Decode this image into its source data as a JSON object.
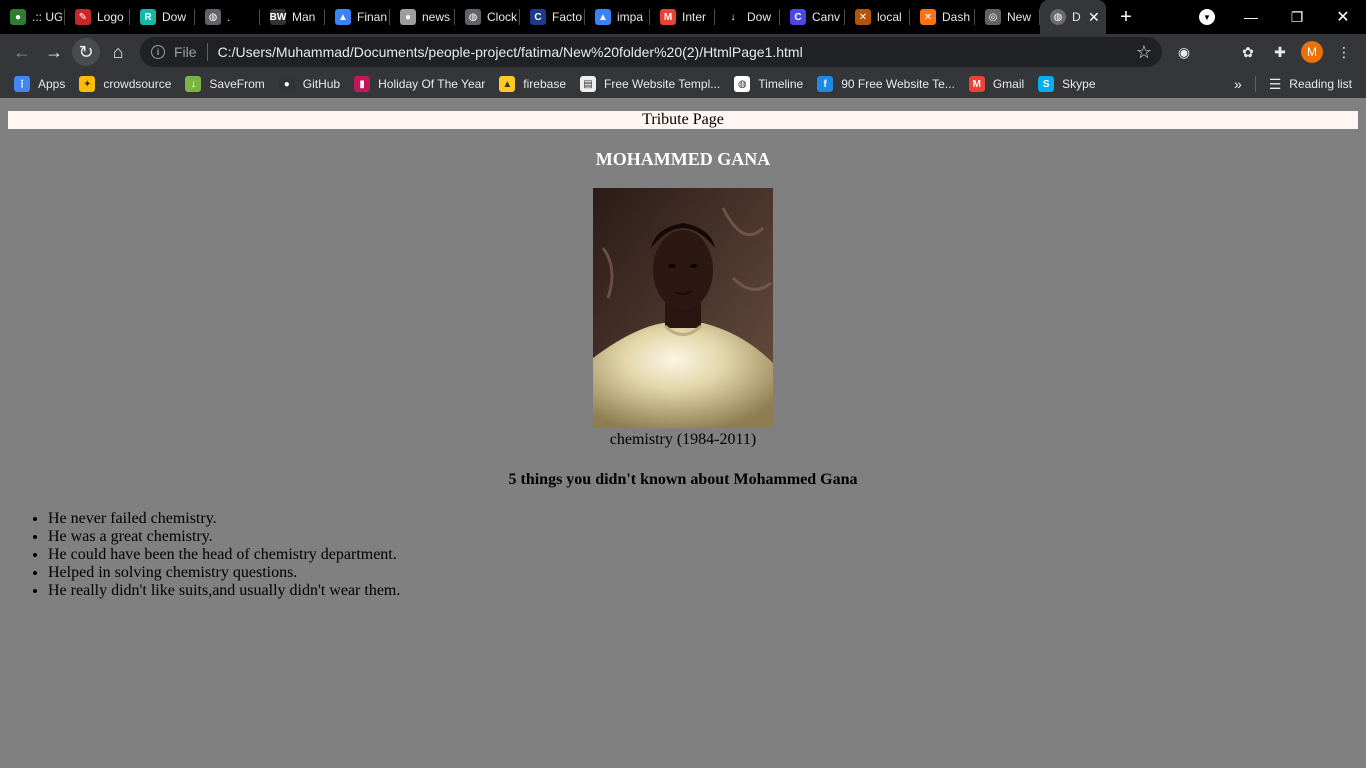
{
  "tabs": [
    {
      "title": ".:: UG",
      "icon": "globe-green-icon",
      "color": "#2e7d32"
    },
    {
      "title": "Logo",
      "icon": "logo-icon",
      "color": "#c62828"
    },
    {
      "title": "Dow",
      "icon": "r-icon",
      "color": "#14b8a6"
    },
    {
      "title": ".",
      "icon": "globe-icon",
      "color": "#5f6368"
    },
    {
      "title": "Man",
      "icon": "bw-icon",
      "color": "#333333"
    },
    {
      "title": "Finan",
      "icon": "grad-cap-icon",
      "color": "#3b82f6"
    },
    {
      "title": "news",
      "icon": "toggle-icon",
      "color": "#9e9e9e"
    },
    {
      "title": "Clock",
      "icon": "globe-icon",
      "color": "#5f6368"
    },
    {
      "title": "Facto",
      "icon": "c-icon",
      "color": "#1e3a8a"
    },
    {
      "title": "impa",
      "icon": "grad-cap-icon",
      "color": "#3b82f6"
    },
    {
      "title": "Inter",
      "icon": "gmail-icon",
      "color": "#ea4335"
    },
    {
      "title": "Dow",
      "icon": "download-icon",
      "color": "#000000"
    },
    {
      "title": "Canv",
      "icon": "canva-icon",
      "color": "#4f46e5"
    },
    {
      "title": "local",
      "icon": "xampp-icon",
      "color": "#b45309"
    },
    {
      "title": "Dash",
      "icon": "xampp-icon",
      "color": "#f97316"
    },
    {
      "title": "New",
      "icon": "chrome-icon",
      "color": "#5f6368"
    }
  ],
  "active_tab": {
    "title": "D",
    "icon": "globe-icon",
    "close": "✕"
  },
  "newtab_label": "+",
  "omnibox": {
    "security_label": "File",
    "url": "C:/Users/Muhammad/Documents/people-project/fatima/New%20folder%20(2)/HtmlPage1.html"
  },
  "profile_initial": "M",
  "bookmarks": [
    {
      "label": "Apps",
      "icon": "apps-grid-icon",
      "color": "#4285f4"
    },
    {
      "label": "crowdsource",
      "icon": "crowdsource-icon",
      "color": "#fbbc05"
    },
    {
      "label": "SaveFrom",
      "icon": "savefrom-download-icon",
      "color": "#7cb342"
    },
    {
      "label": "GitHub",
      "icon": "github-icon",
      "color": "#333333"
    },
    {
      "label": "Holiday Of The Year",
      "icon": "holiday-icon",
      "color": "#c2185b"
    },
    {
      "label": "firebase",
      "icon": "firebase-icon",
      "color": "#ffca28"
    },
    {
      "label": "Free Website Templ...",
      "icon": "ost-icon",
      "color": "#eeeeee"
    },
    {
      "label": "Timeline",
      "icon": "globe-icon",
      "color": "#ffffff"
    },
    {
      "label": "90 Free Website Te...",
      "icon": "f-icon",
      "color": "#1e88e5"
    },
    {
      "label": "Gmail",
      "icon": "gmail-icon",
      "color": "#ea4335"
    },
    {
      "label": "Skype",
      "icon": "skype-icon",
      "color": "#00aff0"
    }
  ],
  "reading_list": "Reading list",
  "page": {
    "header": "Tribute Page",
    "name": "MOHAMMED GANA",
    "caption": "chemistry (1984-2011)",
    "subheading": "5 things you didn't known about Mohammed Gana",
    "facts": [
      "He never failed chemistry.",
      "He was a great chemistry.",
      "He could have been the head of chemistry department.",
      "Helped in solving chemistry questions.",
      "He really didn't like suits,and usually didn't wear them."
    ]
  }
}
